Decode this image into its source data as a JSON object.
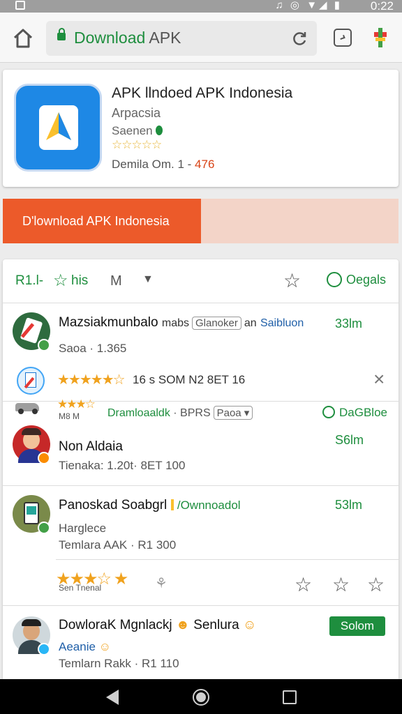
{
  "status_bar": {
    "time": "0:22",
    "icons": "♫ ◎ ▼◢ ▮"
  },
  "browser": {
    "url_brand": "Download",
    "url_rest": " APK"
  },
  "app": {
    "title": "APK llndoed APK Indonesia",
    "developer": "Arpacsia",
    "category": "Saenen",
    "stars": "☆☆☆☆☆",
    "meta_label": "Demila Om. 1 - ",
    "meta_value": "476",
    "icon_color": "#1e88e5"
  },
  "download_bar": {
    "label": "D'lownload APK Indonesia",
    "progress": 0.5
  },
  "toolbar": {
    "label_left": "R1.l-",
    "label_right": "his",
    "sort_glyph": "M",
    "details_label": "Oegals"
  },
  "rows": [
    {
      "title": "Mazsiakmunbalo",
      "title_extra": "mabs",
      "chip": "Glanoker",
      "on": "an",
      "tag": "Saibluon",
      "sub": "Saoa · 1.365",
      "size": "33lm"
    },
    {
      "rating_text": "16 s SOM N2  8ET 16"
    },
    {
      "line_text": "M8 M",
      "link": "Dramloaaldk",
      "apps": "· BPRS",
      "chip": "Paoa ▾",
      "action": "DaGBloe"
    },
    {
      "title": "Non Aldaia",
      "sub": "Tienaka: 1.20t· 8ET 100",
      "size": "S6lm"
    },
    {
      "title": "Panoskad Soabgrl",
      "link": "/Ownnoadol",
      "sub1": "Harglece",
      "sub2": "Temlara AAK · R1 300",
      "size": "53lm"
    },
    {
      "caption": "Sen Tnenal"
    },
    {
      "title": "DowloraK Mgnlackj",
      "title_extra": "Senlura",
      "sub1": "Aeanie",
      "sub2": "Temlarn Rakk · R1 110",
      "button": "Solom"
    }
  ]
}
